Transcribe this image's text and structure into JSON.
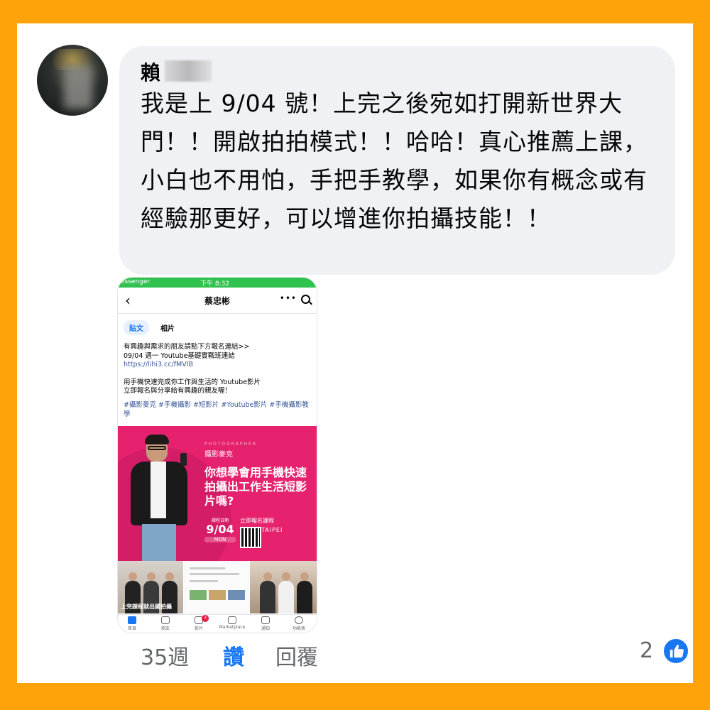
{
  "comment": {
    "author_name": "賴",
    "message": "我是上 9/04 號！上完之後宛如打開新世界大門！！開啟拍拍模式！！哈哈！真心推薦上課，小白也不用怕，手把手教學，如果你有概念或有經驗那更好，可以增進你拍攝技能！！",
    "time_ago": "35週",
    "like_label": "讚",
    "reply_label": "回覆",
    "reaction_count": "2"
  },
  "screenshot": {
    "status": {
      "app": "essenger",
      "time": "下午 8:32"
    },
    "page_title": "蔡忠彬",
    "tabs": [
      "貼文",
      "相片"
    ],
    "post_lines": [
      "有興趣與需求的朋友請點下方報名連結>>",
      "09/04 週一 Youtube基礎實戰班連結",
      "https://lihi3.cc/fMVIB",
      "用手機快速完成你工作與生活的 Youtube影片",
      "立即報名與分享給有興趣的親友喔！"
    ],
    "hashtags": "#攝影麥克 #手機攝影 #短影片 #Youtube影片 #手機攝影教學",
    "banner": {
      "photographer": "PHOTOGRAPHER",
      "brand": "攝影麥克",
      "headline": "你想學會用手機快速拍攝出工作生活短影片嗎?",
      "date_label": "課程日期",
      "date": "9/04",
      "weekday": "MON",
      "signup": "立即報名課程",
      "city": "TAIPEI"
    },
    "thumb_caption": "上完課程就出國拍攝",
    "tabbar": [
      "首頁",
      "朋友",
      "影片",
      "Marketplace",
      "通知",
      "功能表"
    ],
    "video_badge": "3"
  },
  "colors": {
    "accent": "#1877f2",
    "border": "#ffa30a",
    "bubble": "#eff1f4",
    "banner": "#e6226e"
  }
}
